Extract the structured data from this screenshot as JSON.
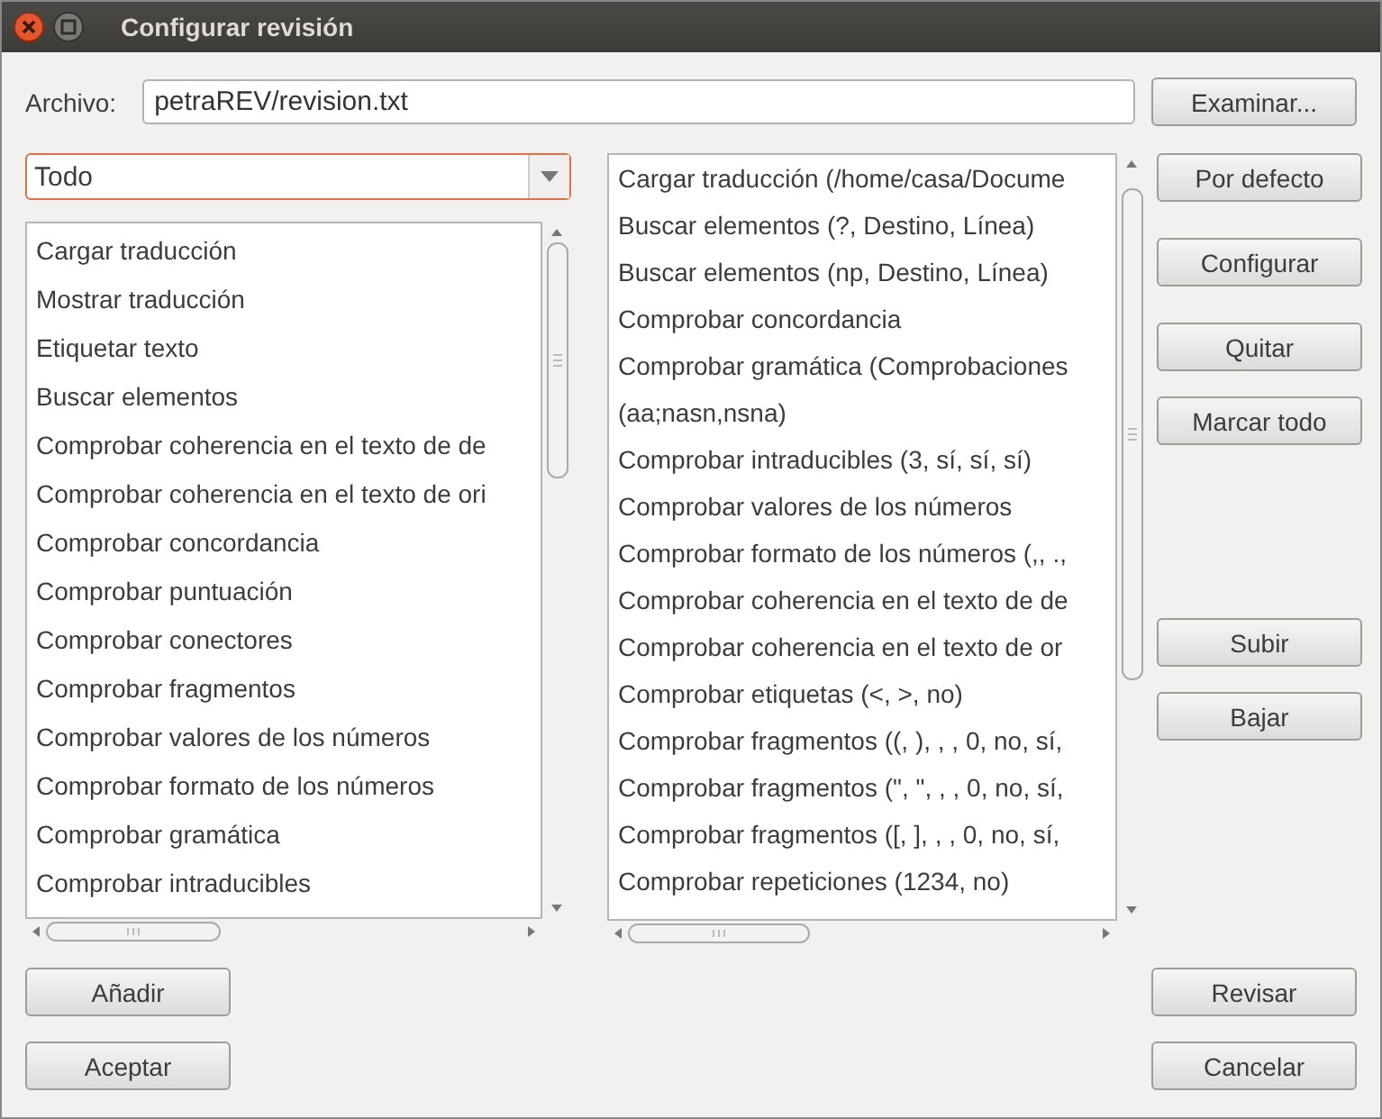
{
  "window": {
    "title": "Configurar revisión"
  },
  "file": {
    "label": "Archivo:",
    "value": "petraREV/revision.txt",
    "button": "Examinar..."
  },
  "filter": {
    "value": "Todo"
  },
  "available": {
    "items": [
      {
        "label": "Cargar traducción"
      },
      {
        "label": "Mostrar traducción"
      },
      {
        "label": "Etiquetar texto"
      },
      {
        "label": "Buscar elementos"
      },
      {
        "label": "Comprobar coherencia en el texto de de"
      },
      {
        "label": "Comprobar coherencia en el texto de ori"
      },
      {
        "label": "Comprobar concordancia"
      },
      {
        "label": "Comprobar puntuación"
      },
      {
        "label": "Comprobar conectores"
      },
      {
        "label": "Comprobar fragmentos"
      },
      {
        "label": "Comprobar valores de los números"
      },
      {
        "label": "Comprobar formato de los números"
      },
      {
        "label": "Comprobar gramática"
      },
      {
        "label": "Comprobar intraducibles"
      }
    ]
  },
  "selected_steps": {
    "items": [
      {
        "label": "Cargar traducción (/home/casa/Docume"
      },
      {
        "label": "Buscar elementos (?, Destino, Línea)"
      },
      {
        "label": "Buscar elementos (np, Destino, Línea)"
      },
      {
        "label": "Comprobar concordancia"
      },
      {
        "label": "Comprobar gramática (Comprobaciones"
      },
      {
        "label": " (aa;nasn,nsna)"
      },
      {
        "label": "Comprobar intraducibles (3, sí, sí, sí)"
      },
      {
        "label": "Comprobar valores de los números"
      },
      {
        "label": "Comprobar formato de los números (,, .,"
      },
      {
        "label": "Comprobar coherencia en el texto de de"
      },
      {
        "label": "Comprobar coherencia en el texto de or"
      },
      {
        "label": "Comprobar etiquetas (<, >, no)"
      },
      {
        "label": "Comprobar fragmentos ((, ),  , , 0, no, sí,"
      },
      {
        "label": "Comprobar fragmentos (\", \",  , , 0, no, sí,"
      },
      {
        "label": "Comprobar fragmentos ([, ],  , , 0, no, sí,"
      },
      {
        "label": "Comprobar repeticiones (1234, no)"
      }
    ]
  },
  "side_buttons": {
    "top": [
      "Por defecto",
      "Configurar",
      "Quitar",
      "Marcar todo"
    ],
    "move": [
      "Subir",
      "Bajar"
    ]
  },
  "bottom_left": [
    "Añadir",
    "Aceptar"
  ],
  "bottom_right": [
    "Revisar",
    "Cancelar"
  ]
}
